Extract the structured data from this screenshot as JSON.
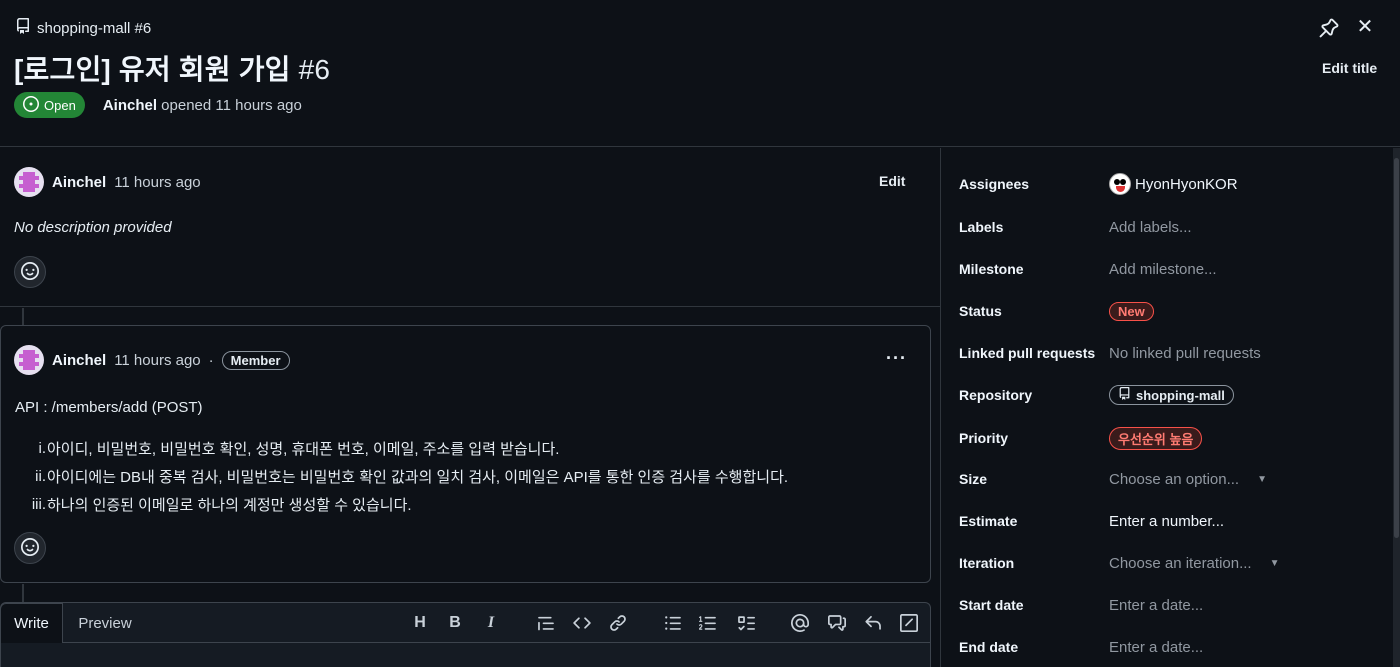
{
  "header": {
    "repo": "shopping-mall #6",
    "title": "[로그인] 유저 회원 가입",
    "number": "#6",
    "state": "Open",
    "author": "Ainchel",
    "opened_text": "opened 11 hours ago",
    "edit_title": "Edit title"
  },
  "first_comment": {
    "author": "Ainchel",
    "time": "11 hours ago",
    "edit": "Edit",
    "body": "No description provided"
  },
  "comment": {
    "author": "Ainchel",
    "time": "11 hours ago",
    "dot": "·",
    "badge": "Member",
    "menu": "···",
    "api_line": "API : /members/add (POST)",
    "items": [
      {
        "marker": "i.",
        "text": "아이디, 비밀번호, 비밀번호 확인, 성명, 휴대폰 번호, 이메일, 주소를 입력 받습니다."
      },
      {
        "marker": "ii.",
        "text": "아이디에는 DB내 중복 검사, 비밀번호는 비밀번호 확인 값과의 일치 검사, 이메일은 API를 통한 인증 검사를 수행합니다."
      },
      {
        "marker": "iii.",
        "text": "하나의 인증된 이메일로 하나의 계정만 생성할 수 있습니다."
      }
    ]
  },
  "editor": {
    "tabs": [
      "Write",
      "Preview"
    ],
    "toolbar_heading": "H",
    "toolbar_bold": "B",
    "toolbar_italic": "I"
  },
  "sidebar": {
    "assignees_label": "Assignees",
    "assignee": "HyonHyonKOR",
    "labels_label": "Labels",
    "labels_value": "Add labels...",
    "milestone_label": "Milestone",
    "milestone_value": "Add milestone...",
    "status_label": "Status",
    "status_value": "New",
    "linked_label": "Linked pull requests",
    "linked_value": "No linked pull requests",
    "repository_label": "Repository",
    "repository_value": "shopping-mall",
    "priority_label": "Priority",
    "priority_value": "우선순위 높음",
    "size_label": "Size",
    "size_value": "Choose an option...",
    "estimate_label": "Estimate",
    "estimate_value": "Enter a number...",
    "iteration_label": "Iteration",
    "iteration_value": "Choose an iteration...",
    "start_label": "Start date",
    "start_value": "Enter a date...",
    "end_label": "End date",
    "end_value": "Enter a date..."
  },
  "colors": {
    "background": "#0d1117",
    "open_badge": "#238636",
    "status_red": "#f85149",
    "border": "#30363d"
  },
  "icons": [
    "repo-icon",
    "pin-icon",
    "close-icon",
    "issue-open-icon",
    "smiley-icon",
    "kebab-icon",
    "heading-icon",
    "bold-icon",
    "italic-icon",
    "quote-icon",
    "code-icon",
    "link-icon",
    "unordered-list-icon",
    "ordered-list-icon",
    "task-list-icon",
    "mention-icon",
    "reference-icon",
    "reply-icon",
    "slash-command-icon",
    "caret-down-icon"
  ]
}
